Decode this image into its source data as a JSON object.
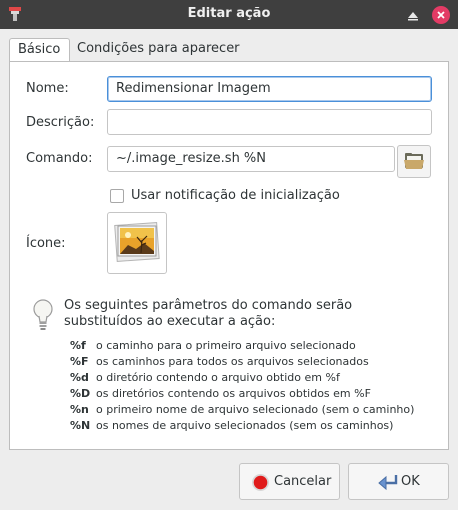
{
  "window": {
    "title": "Editar ação",
    "icons": {
      "app": "app-icon",
      "up": "arrow-up-icon",
      "close": "close-icon"
    }
  },
  "tabs": [
    {
      "label": "Básico",
      "active": true
    },
    {
      "label": "Condições para aparecer",
      "active": false
    }
  ],
  "form": {
    "name_label": "Nome:",
    "name_value": "Redimensionar Imagem",
    "description_label": "Descrição:",
    "description_value": "",
    "command_label": "Comando:",
    "command_value": "~/.image_resize.sh %N",
    "browse_icon": "folder-open-icon",
    "startup_notification_label": "Usar notificação de inicialização",
    "startup_notification_checked": false,
    "icon_label": "Ícone:",
    "icon_name": "image-icon"
  },
  "info": {
    "icon": "lightbulb-icon",
    "line1": "Os seguintes parâmetros do comando serão",
    "line2": "substituídos ao executar a ação:",
    "params": [
      {
        "key": "%f",
        "desc": "o caminho para o primeiro arquivo selecionado"
      },
      {
        "key": "%F",
        "desc": "os caminhos para todos os arquivos selecionados"
      },
      {
        "key": "%d",
        "desc": "o diretório contendo o arquivo obtido em %f"
      },
      {
        "key": "%D",
        "desc": "os diretórios contendo os arquivos obtidos em %F"
      },
      {
        "key": "%n",
        "desc": "o primeiro nome de arquivo selecionado (sem o caminho)"
      },
      {
        "key": "%N",
        "desc": "os nomes de arquivo selecionados (sem os caminhos)"
      }
    ]
  },
  "buttons": {
    "cancel_label": "Cancelar",
    "ok_label": "OK",
    "cancel_icon": "stop-icon",
    "ok_icon": "enter-arrow-icon"
  },
  "colors": {
    "titlebar": "#3f3f3f",
    "close": "#e33b65",
    "focus": "#4a90d9"
  }
}
